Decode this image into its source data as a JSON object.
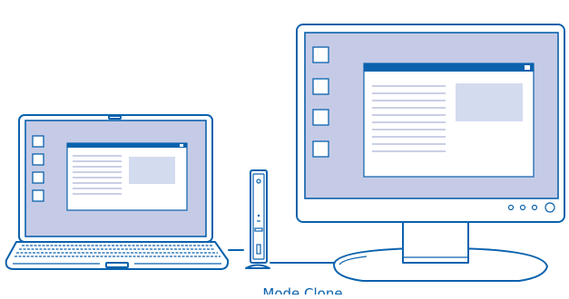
{
  "caption": {
    "text": "Mode Clone"
  },
  "colors": {
    "line": "#0a62ad",
    "screen": "#c5cbe6",
    "window_bar": "#0a62ad",
    "window_bg": "#ffffff",
    "thumbnail": "#d3dbef",
    "device_fill": "#ffffff"
  },
  "devices": {
    "laptop": {
      "desktop_icons": 4,
      "text_lines": 8
    },
    "monitor": {
      "desktop_icons": 4,
      "text_lines": 10,
      "control_buttons": 4
    },
    "dock": {
      "type": "vertical-docking-station"
    }
  }
}
